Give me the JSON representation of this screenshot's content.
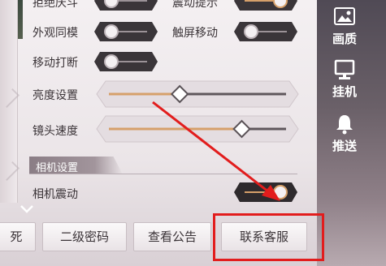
{
  "settings": {
    "reject_team": "拒绝庆斗",
    "vibration_hint": "震动提示",
    "appearance_sync": "外观同模",
    "touch_move": "触屏移动",
    "move_interrupt": "移动打断",
    "brightness": "亮度设置",
    "camera_speed": "镜头速度",
    "camera_section": "相机设置",
    "camera_shake": "相机震动"
  },
  "sliders": {
    "brightness_level": 0.4,
    "camera_speed_level": 0.75
  },
  "sidebar": {
    "quality": "画质",
    "idle": "挂机",
    "push": "推送"
  },
  "buttons": {
    "partial_left": "死",
    "second_password": "二级密码",
    "view_notice": "查看公告",
    "contact_service": "联系客服"
  },
  "colors": {
    "highlight": "#e21d1d",
    "arrow": "#e21d1d",
    "toggle_on": "#2e2a2d",
    "slider_fill": "#d6a06a"
  }
}
